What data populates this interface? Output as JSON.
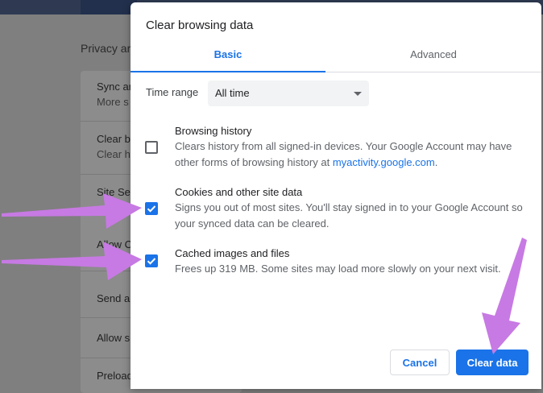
{
  "background": {
    "section_title": "Privacy ar",
    "rows": [
      {
        "title": "Sync ar",
        "sub": "More s"
      },
      {
        "title": "Clear b",
        "sub": "Clear h"
      },
      {
        "title": "Site Se",
        "sub": ""
      },
      {
        "title": "Allow C",
        "sub": ""
      },
      {
        "title": "Send a",
        "sub": ""
      },
      {
        "title": "Allow s",
        "sub": ""
      },
      {
        "title": "Preload",
        "sub": ""
      }
    ]
  },
  "dialog": {
    "title": "Clear browsing data",
    "tabs": [
      {
        "label": "Basic",
        "active": true
      },
      {
        "label": "Advanced",
        "active": false
      }
    ],
    "time_range": {
      "label": "Time range",
      "value": "All time"
    },
    "options": [
      {
        "title": "Browsing history",
        "desc_prefix": "Clears history from all signed-in devices. Your Google Account may have other forms of browsing history at ",
        "link": "myactivity.google.com",
        "desc_suffix": ".",
        "checked": false
      },
      {
        "title": "Cookies and other site data",
        "desc": "Signs you out of most sites. You'll stay signed in to your Google Account so your synced data can be cleared.",
        "checked": true
      },
      {
        "title": "Cached images and files",
        "desc": "Frees up 319 MB. Some sites may load more slowly on your next visit.",
        "checked": true
      }
    ],
    "buttons": {
      "cancel": "Cancel",
      "clear": "Clear data"
    }
  },
  "colors": {
    "accent": "#1a73e8",
    "arrow": "#c77ae3"
  }
}
